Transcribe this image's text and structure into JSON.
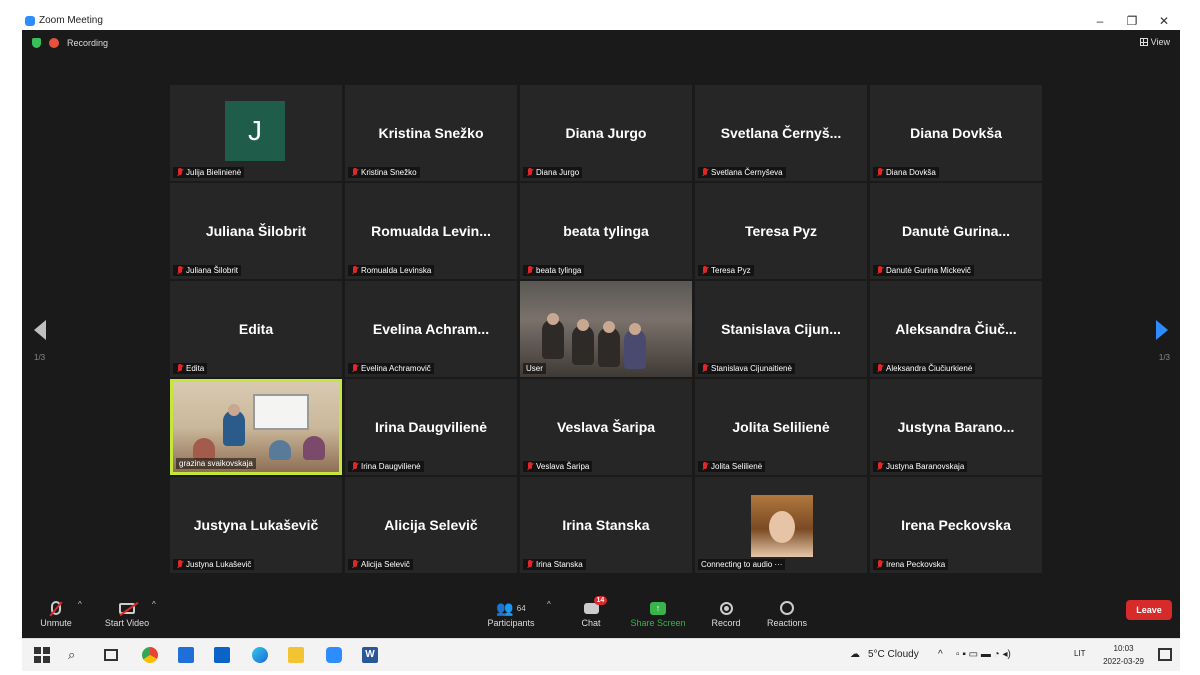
{
  "window": {
    "title": "Zoom Meeting",
    "controls": [
      "–",
      "❐",
      "✕"
    ]
  },
  "meeting": {
    "recording_label": "Recording",
    "view_label": "View",
    "page_left": "1/3",
    "page_right": "1/3"
  },
  "tiles": [
    {
      "name": "",
      "label": "Julija Bielinienė",
      "kind": "avatar",
      "avatar_letter": "J"
    },
    {
      "name": "Kristina Snežko",
      "label": "Kristina Snežko"
    },
    {
      "name": "Diana Jurgo",
      "label": "Diana Jurgo"
    },
    {
      "name": "Svetlana Černyš...",
      "label": "Svetlana Černyševa"
    },
    {
      "name": "Diana Dovkša",
      "label": "Diana Dovkša"
    },
    {
      "name": "Juliana Šilobrit",
      "label": "Juliana Šilobrit"
    },
    {
      "name": "Romualda Levin...",
      "label": "Romualda Levinska"
    },
    {
      "name": "beata tylinga",
      "label": "beata tylinga"
    },
    {
      "name": "Teresa Pyz",
      "label": "Teresa Pyz"
    },
    {
      "name": "Danutė Gurina...",
      "label": "Danutė Gurina Mickevič"
    },
    {
      "name": "Edita",
      "label": "Edita"
    },
    {
      "name": "Evelina Achram...",
      "label": "Evelina Achramovič"
    },
    {
      "name": "",
      "label": "User",
      "kind": "video-group"
    },
    {
      "name": "Stanislava Cijun...",
      "label": "Stanislava Cijunaitienė"
    },
    {
      "name": "Aleksandra Čiuč...",
      "label": "Aleksandra Čiučiurkienė"
    },
    {
      "name": "",
      "label": "grazina svaikovskaja",
      "kind": "video-classroom",
      "active": true
    },
    {
      "name": "Irina Daugvilienė",
      "label": "Irina Daugvilienė"
    },
    {
      "name": "Veslava Šaripa",
      "label": "Veslava Šaripa"
    },
    {
      "name": "Jolita Selilienė",
      "label": "Jolita Selilienė"
    },
    {
      "name": "Justyna Barano...",
      "label": "Justyna Baranovskaja"
    },
    {
      "name": "Justyna Lukaševič",
      "label": "Justyna Lukaševič"
    },
    {
      "name": "Alicija Selevič",
      "label": "Alicija Selevič"
    },
    {
      "name": "Irina Stanska",
      "label": "Irina Stanska"
    },
    {
      "name": "",
      "label": "Connecting to audio ···",
      "kind": "photo"
    },
    {
      "name": "Irena Peckovska",
      "label": "Irena Peckovska"
    }
  ],
  "toolbar": {
    "unmute": "Unmute",
    "start_video": "Start Video",
    "participants": "Participants",
    "participant_count": "64",
    "chat": "Chat",
    "chat_badge": "14",
    "share_screen": "Share Screen",
    "record": "Record",
    "reactions": "Reactions",
    "leave": "Leave"
  },
  "taskbar": {
    "weather": "5°C Cloudy",
    "language": "LIT",
    "time": "10:03",
    "date": "2022-03-29"
  },
  "colors": {
    "meeting_bg": "#1a1a1a",
    "tile_bg": "#262626",
    "active_speaker": "#c5e63a",
    "share_green": "#38b44a",
    "leave_red": "#d72b2b",
    "zoom_blue": "#2d8cff"
  }
}
